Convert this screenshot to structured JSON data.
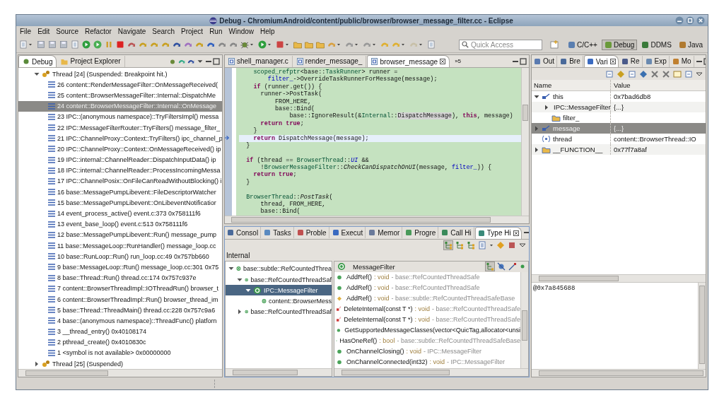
{
  "window": {
    "title": "Debug - ChromiumAndroid/content/public/browser/browser_message_filter.cc - Eclipse"
  },
  "menu": [
    "File",
    "Edit",
    "Source",
    "Refactor",
    "Navigate",
    "Search",
    "Project",
    "Run",
    "Window",
    "Help"
  ],
  "quick_access": {
    "placeholder": "Quick Access"
  },
  "perspectives": [
    {
      "label": "C/C++",
      "selected": false
    },
    {
      "label": "Debug",
      "selected": true
    },
    {
      "label": "DDMS",
      "selected": false
    },
    {
      "label": "Java",
      "selected": false
    }
  ],
  "debug_view": {
    "tabs": [
      {
        "label": "Debug",
        "selected": true
      },
      {
        "label": "Project Explorer",
        "selected": false
      }
    ],
    "threads": [
      {
        "label": "Thread [24] (Suspended: Breakpoint hit.)",
        "expanded": true,
        "frames": [
          {
            "label": "26 content::RenderMessageFilter::OnMessageReceived(",
            "selected": false
          },
          {
            "label": "25 content::BrowserMessageFilter::Internal::DispatchMe",
            "selected": false
          },
          {
            "label": "24 content::BrowserMessageFilter::Internal::OnMessage",
            "selected": true
          },
          {
            "label": "23 IPC::(anonymous namespace)::TryFiltersImpl() messa",
            "selected": false
          },
          {
            "label": "22 IPC::MessageFilterRouter::TryFilters() message_filter_",
            "selected": false
          },
          {
            "label": "21 IPC::ChannelProxy::Context::TryFilters() ipc_channel_p",
            "selected": false
          },
          {
            "label": "20 IPC::ChannelProxy::Context::OnMessageReceived() ip",
            "selected": false
          },
          {
            "label": "19 IPC::internal::ChannelReader::DispatchInputData() ip",
            "selected": false
          },
          {
            "label": "18 IPC::internal::ChannelReader::ProcessIncomingMessa",
            "selected": false
          },
          {
            "label": "17 IPC::ChannelPosix::OnFileCanReadWithoutBlocking() i",
            "selected": false
          },
          {
            "label": "16 base::MessagePumpLibevent::FileDescriptorWatcher",
            "selected": false
          },
          {
            "label": "15 base::MessagePumpLibevent::OnLibeventNotificatior",
            "selected": false
          },
          {
            "label": "14 event_process_active() event.c:373 0x758111f6",
            "selected": false
          },
          {
            "label": "13 event_base_loop() event.c:513 0x758111f6",
            "selected": false
          },
          {
            "label": "12 base::MessagePumpLibevent::Run() message_pump",
            "selected": false
          },
          {
            "label": "11 base::MessageLoop::RunHandler() message_loop.cc",
            "selected": false
          },
          {
            "label": "10 base::RunLoop::Run() run_loop.cc:49 0x757bb660",
            "selected": false
          },
          {
            "label": "9 base::MessageLoop::Run() message_loop.cc:301 0x75",
            "selected": false
          },
          {
            "label": "8 base::Thread::Run() thread.cc:174 0x757c937e",
            "selected": false
          },
          {
            "label": "7 content::BrowserThreadImpl::IOThreadRun() browser_t",
            "selected": false
          },
          {
            "label": "6 content::BrowserThreadImpl::Run() browser_thread_im",
            "selected": false
          },
          {
            "label": "5 base::Thread::ThreadMain() thread.cc:228 0x757c9a6",
            "selected": false
          },
          {
            "label": "4 base::(anonymous namespace)::ThreadFunc() platforn",
            "selected": false
          },
          {
            "label": "3 __thread_entry()  0x40108174",
            "selected": false
          },
          {
            "label": "2 pthread_create()  0x4010830c",
            "selected": false
          },
          {
            "label": "1 <symbol is not available> 0x00000000",
            "selected": false
          }
        ]
      },
      {
        "label": "Thread [25] (Suspended)",
        "expanded": false
      }
    ]
  },
  "editor": {
    "tabs": [
      {
        "label": "shell_manager.c",
        "selected": false
      },
      {
        "label": "render_message_",
        "selected": false
      },
      {
        "label": "browser_message",
        "selected": true
      }
    ],
    "overflow": "»5",
    "lines": [
      {
        "current": false,
        "kind": "code",
        "tokens": [
          {
            "text": "    scoped_refptr",
            "kind": "type"
          },
          {
            "text": "<base::",
            "kind": "plain"
          },
          {
            "text": "TaskRunner",
            "kind": "type"
          },
          {
            "text": "> runner =",
            "kind": "plain"
          }
        ]
      },
      {
        "current": false,
        "kind": "code",
        "tokens": [
          {
            "text": "        filter_",
            "kind": "field"
          },
          {
            "text": "->OverrideTaskRunnerForMessage(message);",
            "kind": "plain"
          }
        ]
      },
      {
        "current": false,
        "kind": "code",
        "tokens": [
          {
            "text": "    if",
            "kind": "keyword"
          },
          {
            "text": " (runner.get()) {",
            "kind": "plain"
          }
        ]
      },
      {
        "current": false,
        "kind": "code",
        "tokens": [
          {
            "text": "      runner->PostTask(",
            "kind": "plain"
          }
        ]
      },
      {
        "current": false,
        "kind": "code",
        "tokens": [
          {
            "text": "          FROM_HERE,",
            "kind": "plain"
          }
        ]
      },
      {
        "current": false,
        "kind": "code",
        "tokens": [
          {
            "text": "          base::Bind(",
            "kind": "plain"
          }
        ]
      },
      {
        "current": false,
        "kind": "code",
        "tokens": [
          {
            "text": "              base::IgnoreResult(&",
            "kind": "plain"
          },
          {
            "text": "Internal",
            "kind": "type"
          },
          {
            "text": "::",
            "kind": "plain"
          },
          {
            "text": "DispatchMessage",
            "kind": "occurrence"
          },
          {
            "text": "), ",
            "kind": "plain"
          },
          {
            "text": "this",
            "kind": "keyword"
          },
          {
            "text": ", message)",
            "kind": "plain"
          }
        ]
      },
      {
        "current": false,
        "kind": "code",
        "tokens": [
          {
            "text": "      return true",
            "kind": "keyword"
          },
          {
            "text": ";",
            "kind": "plain"
          }
        ]
      },
      {
        "current": false,
        "kind": "code",
        "tokens": [
          {
            "text": "    }",
            "kind": "plain"
          }
        ]
      },
      {
        "current": true,
        "kind": "code",
        "tokens": [
          {
            "text": "    return",
            "kind": "keyword"
          },
          {
            "text": " DispatchMessage(message);",
            "kind": "plain"
          }
        ]
      },
      {
        "current": false,
        "kind": "code",
        "tokens": [
          {
            "text": "  }",
            "kind": "plain"
          }
        ]
      },
      {
        "kind": "blank"
      },
      {
        "current": false,
        "kind": "code",
        "tokens": [
          {
            "text": "  if",
            "kind": "keyword"
          },
          {
            "text": " (thread == ",
            "kind": "plain"
          },
          {
            "text": "BrowserThread",
            "kind": "type"
          },
          {
            "text": "::",
            "kind": "plain"
          },
          {
            "text": "UI",
            "kind": "static_field"
          },
          {
            "text": " &&",
            "kind": "plain"
          }
        ]
      },
      {
        "current": false,
        "kind": "code",
        "tokens": [
          {
            "text": "      !",
            "kind": "plain"
          },
          {
            "text": "BrowserMessageFilter",
            "kind": "type"
          },
          {
            "text": "::",
            "kind": "plain"
          },
          {
            "text": "CheckCanDispatchOnUI",
            "kind": "static_method"
          },
          {
            "text": "(message, ",
            "kind": "plain"
          },
          {
            "text": "filter_",
            "kind": "field"
          },
          {
            "text": ")) {",
            "kind": "plain"
          }
        ]
      },
      {
        "current": false,
        "kind": "code",
        "tokens": [
          {
            "text": "    return true",
            "kind": "keyword"
          },
          {
            "text": ";",
            "kind": "plain"
          }
        ]
      },
      {
        "current": false,
        "kind": "code",
        "tokens": [
          {
            "text": "  }",
            "kind": "plain"
          }
        ]
      },
      {
        "kind": "blank"
      },
      {
        "current": false,
        "kind": "code",
        "tokens": [
          {
            "text": "  BrowserThread",
            "kind": "type"
          },
          {
            "text": "::",
            "kind": "plain"
          },
          {
            "text": "PostTask",
            "kind": "static_method"
          },
          {
            "text": "(",
            "kind": "plain"
          }
        ]
      },
      {
        "current": false,
        "kind": "code",
        "tokens": [
          {
            "text": "      thread, FROM_HERE,",
            "kind": "plain"
          }
        ]
      },
      {
        "current": false,
        "kind": "code",
        "tokens": [
          {
            "text": "      base::Bind(",
            "kind": "plain"
          }
        ]
      }
    ]
  },
  "bottom_view": {
    "tabs": [
      {
        "label": "Consol",
        "selected": false
      },
      {
        "label": "Tasks",
        "selected": false
      },
      {
        "label": "Proble",
        "selected": false
      },
      {
        "label": "Execut",
        "selected": false
      },
      {
        "label": "Memor",
        "selected": false
      },
      {
        "label": "Progre",
        "selected": false
      },
      {
        "label": "Call Hi",
        "selected": false
      },
      {
        "label": "Type Hi",
        "selected": true
      }
    ]
  },
  "type_hierarchy": {
    "label": "Internal",
    "tree": [
      {
        "label": "base::subtle::RefCountedThrea",
        "expanded": true,
        "selected": false,
        "children": [
          {
            "label": "base::RefCountedThreadSaf",
            "expanded": true,
            "selected": false,
            "children": [
              {
                "label": "IPC::MessageFilter",
                "expanded": true,
                "selected": true,
                "children": [
                  {
                    "label": "content::BrowserMess",
                    "selected": false
                  }
                ]
              }
            ]
          },
          {
            "label": "base::RefCountedThreadSaf",
            "expanded": false,
            "selected": false
          }
        ]
      }
    ],
    "members_title": "MessageFilter",
    "members": [
      {
        "name": "AddRef()",
        "return_type": ": void",
        "declaring_type": "- base::RefCountedThreadSafe",
        "kind": "public"
      },
      {
        "name": "AddRef()",
        "return_type": ": void",
        "declaring_type": "- base::RefCountedThreadSafe",
        "kind": "public"
      },
      {
        "name": "AddRef()",
        "return_type": ": void",
        "declaring_type": "- base::subtle::RefCountedThreadSafeBase",
        "kind": "protected"
      },
      {
        "name": "DeleteInternal(const T *)",
        "return_type": ": void",
        "declaring_type": "- base::RefCountedThreadSafe",
        "kind": "private_static"
      },
      {
        "name": "DeleteInternal(const T *)",
        "return_type": ": void",
        "declaring_type": "- base::RefCountedThreadSafe",
        "kind": "private_static"
      },
      {
        "name": "GetSupportedMessageClasses(vector<QuicTag,allocator<unsi",
        "kind": "public"
      },
      {
        "name": "HasOneRef()",
        "return_type": ": bool",
        "declaring_type": "- base::subtle::RefCountedThreadSafeBase",
        "kind": "public"
      },
      {
        "name": "OnChannelClosing()",
        "return_type": ": void",
        "declaring_type": "- IPC::MessageFilter",
        "kind": "public"
      },
      {
        "name": "OnChannelConnected(int32)",
        "return_type": ": void",
        "declaring_type": "- IPC::MessageFilter",
        "kind": "public"
      }
    ]
  },
  "variables": {
    "tabs": [
      {
        "label": "Out",
        "selected": false
      },
      {
        "label": "Bre",
        "selected": false
      },
      {
        "label": "Vari",
        "selected": true
      },
      {
        "label": "Re",
        "selected": false
      },
      {
        "label": "Exp",
        "selected": false
      },
      {
        "label": "Mo",
        "selected": false
      }
    ],
    "columns": [
      "Name",
      "Value"
    ],
    "rows": [
      {
        "name": "this",
        "value": "0x7bad6db8",
        "kind": "pointer",
        "expanded": true,
        "selected": false,
        "children": [
          {
            "name": "IPC::MessageFilter",
            "value": "{...}",
            "kind": "struct",
            "expanded": false,
            "selected": false
          },
          {
            "name": "filter_",
            "kind": "struct",
            "selected": false
          }
        ]
      },
      {
        "name": "message",
        "value": "{...}",
        "kind": "pointer",
        "expanded": false,
        "selected": true
      },
      {
        "name": "thread",
        "value": "content::BrowserThread::IO",
        "kind": "enum",
        "selected": false
      },
      {
        "name": "__FUNCTION__",
        "value": "0x77f7a8af",
        "kind": "struct",
        "expanded": false,
        "selected": false
      }
    ],
    "detail": "@0x7a845688"
  }
}
